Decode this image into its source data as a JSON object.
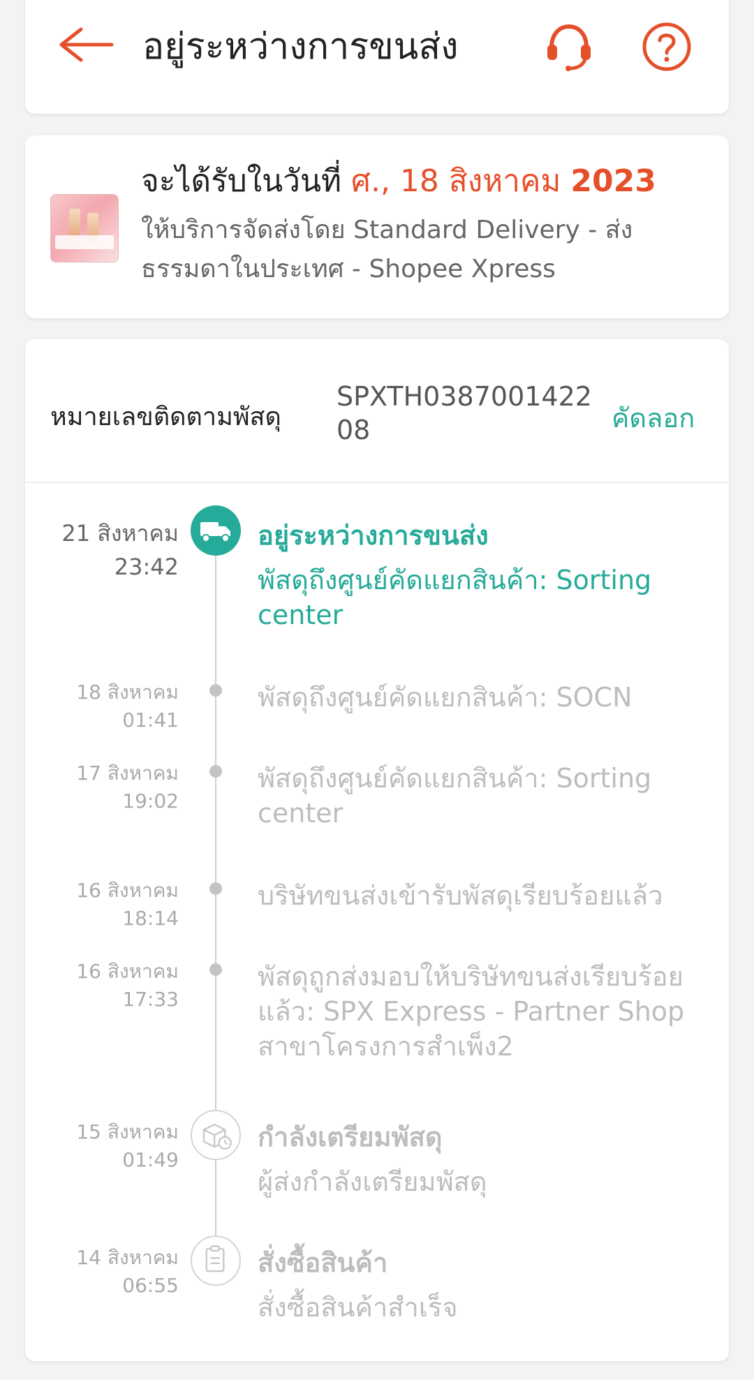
{
  "header": {
    "title": "อยู่ระหว่างการขนส่ง",
    "icons": [
      "back-arrow-icon",
      "support-headset-icon",
      "help-question-icon"
    ]
  },
  "delivery": {
    "prefix": "จะได้รับในวันที่",
    "date_day": "ศ., 18 สิงหาคม",
    "date_year": "2023",
    "service_line": "ให้บริการจัดส่งโดย Standard Delivery - ส่งธรรมดาในประเทศ - Shopee Xpress"
  },
  "tracking": {
    "label": "หมายเลขติดตามพัสดุ",
    "number": "SPXTH038700142208",
    "copy_label": "คัดลอก"
  },
  "events": [
    {
      "date": "21 สิงหาคม",
      "time": "23:42",
      "title": "อยู่ระหว่างการขนส่ง",
      "desc": "พัสดุถึงศูนย์คัดแยกสินค้า: Sorting center",
      "state": "active",
      "icon": "truck-icon"
    },
    {
      "date": "18 สิงหาคม",
      "time": "01:41",
      "desc": "พัสดุถึงศูนย์คัดแยกสินค้า: SOCN"
    },
    {
      "date": "17 สิงหาคม",
      "time": "19:02",
      "desc": "พัสดุถึงศูนย์คัดแยกสินค้า: Sorting center"
    },
    {
      "date": "16 สิงหาคม",
      "time": "18:14",
      "desc": "บริษัทขนส่งเข้ารับพัสดุเรียบร้อยแล้ว"
    },
    {
      "date": "16 สิงหาคม",
      "time": "17:33",
      "desc": "พัสดุถูกส่งมอบให้บริษัทขนส่งเรียบร้อยแล้ว: SPX Express - Partner Shop สาขาโครงการสำเพ็ง2"
    },
    {
      "date": "15 สิงหาคม",
      "time": "01:49",
      "title": "กำลังเตรียมพัสดุ",
      "desc": " ผู้ส่งกำลังเตรียมพัสดุ",
      "icon": "package-clock-icon"
    },
    {
      "date": "14 สิงหาคม",
      "time": "06:55",
      "title": "สั่งซื้อสินค้า",
      "desc": "สั่งซื้อสินค้าสำเร็จ",
      "icon": "clipboard-icon"
    }
  ],
  "colors": {
    "accent": "#e5502b",
    "teal": "#26aa99",
    "muted": "#bdbdbd"
  }
}
